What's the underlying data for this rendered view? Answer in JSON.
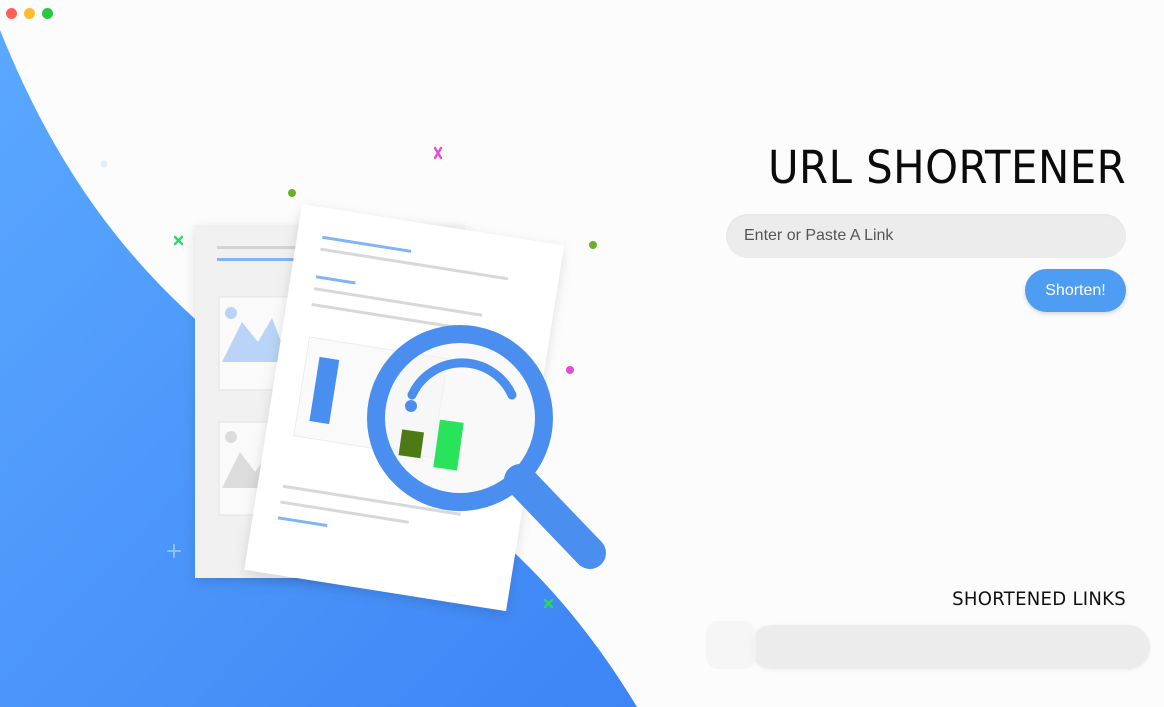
{
  "window": {
    "controls": [
      "close",
      "minimize",
      "maximize"
    ]
  },
  "app": {
    "title": "URL SHORTENER"
  },
  "form": {
    "input_placeholder": "Enter or Paste A Link",
    "input_value": "",
    "submit_label": "Shorten!"
  },
  "results": {
    "section_title": "SHORTENED LINKS",
    "items": []
  },
  "colors": {
    "brand_blue": "#4f9cf3",
    "wave_blue_light": "#5aa8ff",
    "wave_blue_dark": "#3d84f5",
    "input_bg": "#ececec"
  },
  "illustration": {
    "icons": [
      "document-icon",
      "magnifier-icon",
      "bar-chart-icon",
      "image-placeholder-icon"
    ]
  }
}
